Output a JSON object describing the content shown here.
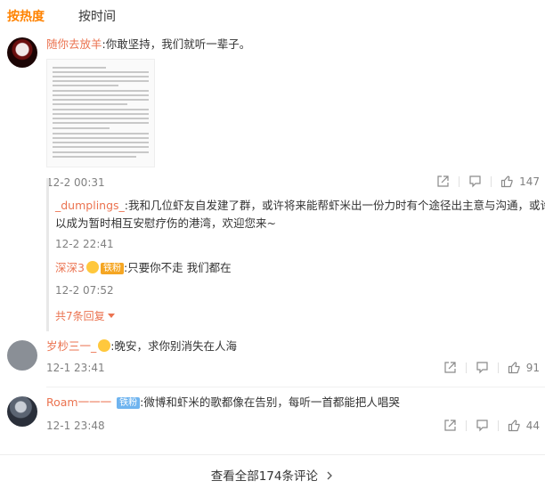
{
  "tabs": [
    {
      "label": "按热度",
      "active": true
    },
    {
      "label": "按时间",
      "active": false
    }
  ],
  "accent_color": "#ff8200",
  "username_color": "#eb7350",
  "comments": [
    {
      "user": "随你去放羊",
      "text": ":你敢坚持，我们就听一辈子。",
      "has_image": true,
      "time": "12-2 00:31",
      "likes": "147",
      "replies": [
        {
          "user": "_dumplings_",
          "text": ":我和几位虾友自发建了群，或许将来能帮虾米出一份力时有个途径出主意与沟通，或许可",
          "text2": "以成为暂时相互安慰疗伤的港湾，欢迎您来~",
          "time": "12-2 22:41"
        },
        {
          "user": "深深3",
          "badge": "铁粉",
          "text": ":只要你不走 我们都在",
          "time": "12-2 07:52"
        }
      ],
      "more_replies": "共7条回复"
    },
    {
      "user": "岁杪三一_",
      "text": ":晚安，求你别消失在人海",
      "time": "12-1 23:41",
      "likes": "91"
    },
    {
      "user": "Roam一一一",
      "badge": "铁粉",
      "text": ":微博和虾米的歌都像在告别，每听一首都能把人唱哭",
      "time": "12-1 23:48",
      "likes": "44"
    }
  ],
  "footer": {
    "label": "查看全部174条评论"
  },
  "icons": [
    "share-icon",
    "comment-icon",
    "like-icon",
    "chevron-right-icon",
    "chevron-down-icon"
  ]
}
